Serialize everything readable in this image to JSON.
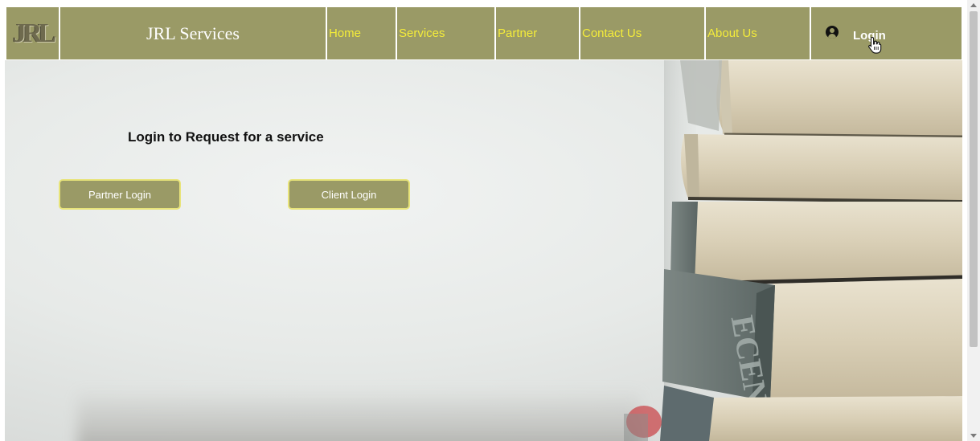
{
  "nav": {
    "logo_text": "JRL",
    "brand": "JRL Services",
    "links": [
      {
        "label": "Home"
      },
      {
        "label": "Services"
      },
      {
        "label": "Partner"
      },
      {
        "label": "Contact Us"
      },
      {
        "label": "About Us"
      }
    ],
    "login_label": "Login",
    "login_icon": "user-circle-icon",
    "link_color": "#f4ec3a",
    "bar_color": "#9a9a66"
  },
  "hero": {
    "title": "Login to Request for a service",
    "partner_button": "Partner Login",
    "client_button": "Client Login",
    "spine_text": "ECENTE"
  }
}
